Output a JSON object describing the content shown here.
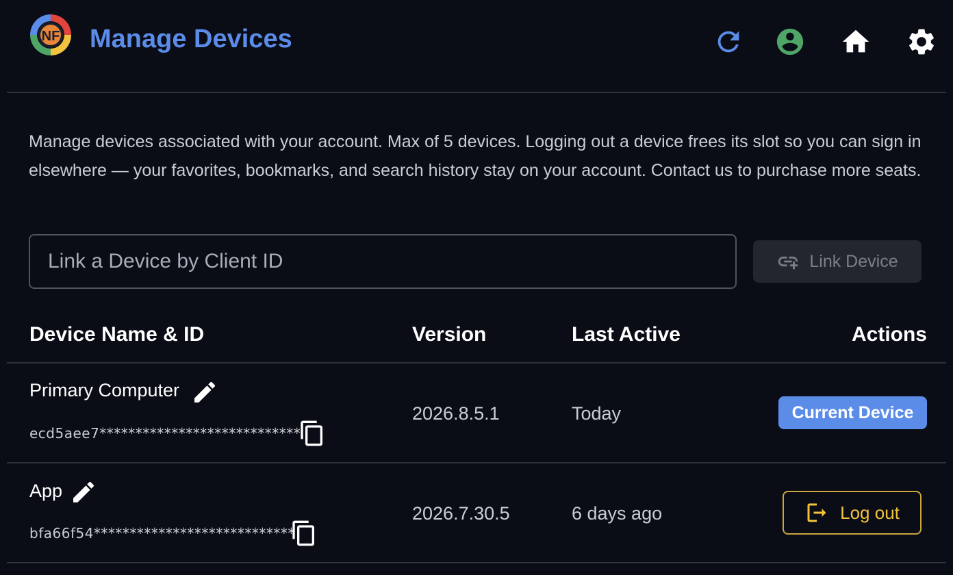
{
  "header": {
    "logo_text": "NF",
    "title": "Manage Devices",
    "icons": {
      "refresh": "refresh-icon",
      "account": "account-circle-icon",
      "home": "home-icon",
      "settings": "gear-icon"
    }
  },
  "description": "Manage devices associated with your account. Max of 5 devices. Logging out a device frees its slot so you can sign in elsewhere — your favorites, bookmarks, and search history stay on your account. Contact us to purchase more seats.",
  "link": {
    "placeholder": "Link a Device by Client ID",
    "button_label": "Link Device"
  },
  "table": {
    "headers": {
      "name": "Device Name & ID",
      "version": "Version",
      "last_active": "Last Active",
      "actions": "Actions"
    },
    "rows": [
      {
        "name": "Primary Computer",
        "id": "ecd5aee7****************************",
        "version": "2026.8.5.1",
        "last_active": "Today",
        "action_label": "Current Device"
      },
      {
        "name": "App",
        "id": "bfa66f54****************************",
        "version": "2026.7.30.5",
        "last_active": "6 days ago",
        "action_label": "Log out"
      }
    ]
  },
  "colors": {
    "background": "#0a0c16",
    "accent_blue": "#5b8ce8",
    "account_green": "#4ea567",
    "logout_gold": "#f2c33c",
    "divider": "#2e323c"
  }
}
